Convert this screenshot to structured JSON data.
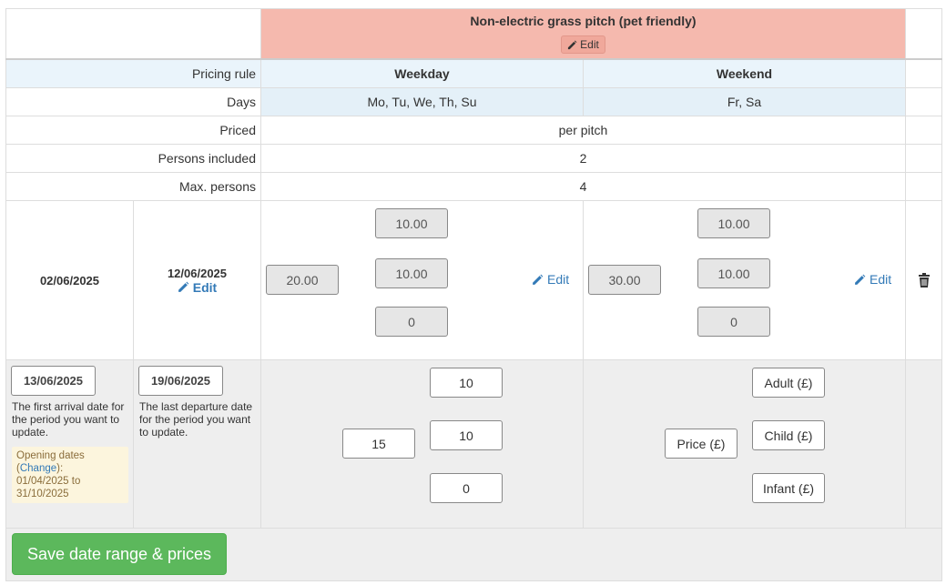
{
  "header": {
    "pitch_title": "Non-electric grass pitch (pet friendly)",
    "edit_label": "Edit"
  },
  "rules": {
    "pricing_rule_label": "Pricing rule",
    "weekday_label": "Weekday",
    "weekend_label": "Weekend",
    "days_label": "Days",
    "weekday_days": "Mo, Tu, We, Th, Su",
    "weekend_days": "Fr, Sa",
    "priced_label": "Priced",
    "priced_value": "per pitch",
    "persons_included_label": "Persons included",
    "persons_included_value": "2",
    "max_persons_label": "Max. persons",
    "max_persons_value": "4"
  },
  "existing_range": {
    "start_date": "02/06/2025",
    "end_date": "12/06/2025",
    "edit_label": "Edit",
    "weekday": {
      "price": "20.00",
      "adult": "10.00",
      "child": "10.00",
      "infant": "0",
      "edit_label": "Edit"
    },
    "weekend": {
      "price": "30.00",
      "adult": "10.00",
      "child": "10.00",
      "infant": "0",
      "edit_label": "Edit"
    }
  },
  "new_range": {
    "start_date": "13/06/2025",
    "end_date": "19/06/2025",
    "start_help": "The first arrival date for the period you want to update.",
    "end_help": "The last departure date for the period you want to update.",
    "opening_prefix": "Opening dates (",
    "opening_change": "Change",
    "opening_suffix": "):",
    "opening_range": "01/04/2025 to 31/10/2025",
    "weekday": {
      "price": "15",
      "adult": "10",
      "child": "10",
      "infant": "0"
    },
    "weekend": {
      "price_placeholder": "Price (£)",
      "adult_placeholder": "Adult (£)",
      "child_placeholder": "Child (£)",
      "infant_placeholder": "Infant (£)"
    }
  },
  "actions": {
    "save_label": "Save date range & prices"
  },
  "colors": {
    "header_bg": "#f5b9ae",
    "save_green": "#5cb85c",
    "link_blue": "#337ab7"
  }
}
